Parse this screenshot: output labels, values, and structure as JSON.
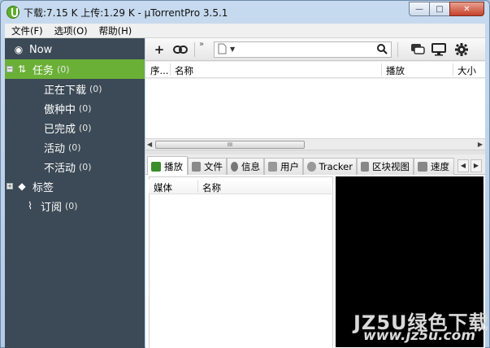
{
  "title": {
    "text": "下载:7.15 K 上传:1.29 K - µTorrentPro 3.5.1",
    "buttons": {
      "minimize": "—",
      "maximize": "□",
      "close": "✕"
    }
  },
  "menu": [
    "文件(F)",
    "选项(O)",
    "帮助(H)"
  ],
  "sidebar": {
    "now": "Now",
    "tasks": {
      "label": "任务",
      "count": "(0)"
    },
    "task_items": [
      {
        "label": "正在下载",
        "count": "(0)"
      },
      {
        "label": "傲种中",
        "count": "(0)"
      },
      {
        "label": "已完成",
        "count": "(0)"
      },
      {
        "label": "活动",
        "count": "(0)"
      },
      {
        "label": "不活动",
        "count": "(0)"
      }
    ],
    "labels": {
      "label": "标签"
    },
    "feeds": {
      "label": "订阅",
      "count": "(0)"
    }
  },
  "toolbar": {
    "overflow": "»"
  },
  "grid": {
    "columns": [
      "序...",
      "名称",
      "播放",
      "大小"
    ],
    "scroll_thumb": "III"
  },
  "tabs": [
    "播放",
    "文件",
    "信息",
    "用户",
    "Tracker",
    "区块视图",
    "速度"
  ],
  "media": {
    "columns": [
      "媒体",
      "名称"
    ]
  },
  "watermark": {
    "line1": "JZ5U绿色下载",
    "line2": "www.jz5u.com"
  }
}
